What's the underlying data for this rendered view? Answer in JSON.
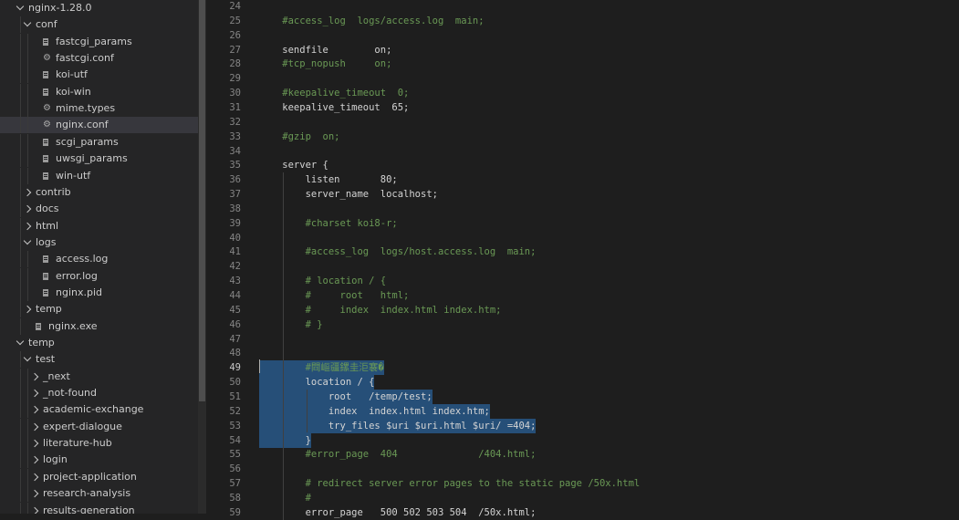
{
  "explorer": {
    "items": [
      {
        "label": "nginx-1.28.0",
        "type": "folder",
        "open": true,
        "depth": 0
      },
      {
        "label": "conf",
        "type": "folder",
        "open": true,
        "depth": 1
      },
      {
        "label": "fastcgi_params",
        "type": "file",
        "icon": "file-lines-icon",
        "depth": 2
      },
      {
        "label": "fastcgi.conf",
        "type": "file",
        "icon": "gear-icon",
        "depth": 2
      },
      {
        "label": "koi-utf",
        "type": "file",
        "icon": "file-lines-icon",
        "depth": 2
      },
      {
        "label": "koi-win",
        "type": "file",
        "icon": "file-lines-icon",
        "depth": 2
      },
      {
        "label": "mime.types",
        "type": "file",
        "icon": "gear-icon",
        "depth": 2
      },
      {
        "label": "nginx.conf",
        "type": "file",
        "icon": "gear-icon",
        "depth": 2,
        "selected": true
      },
      {
        "label": "scgi_params",
        "type": "file",
        "icon": "file-lines-icon",
        "depth": 2
      },
      {
        "label": "uwsgi_params",
        "type": "file",
        "icon": "file-lines-icon",
        "depth": 2
      },
      {
        "label": "win-utf",
        "type": "file",
        "icon": "file-lines-icon",
        "depth": 2
      },
      {
        "label": "contrib",
        "type": "folder",
        "open": false,
        "depth": 1
      },
      {
        "label": "docs",
        "type": "folder",
        "open": false,
        "depth": 1
      },
      {
        "label": "html",
        "type": "folder",
        "open": false,
        "depth": 1
      },
      {
        "label": "logs",
        "type": "folder",
        "open": true,
        "depth": 1
      },
      {
        "label": "access.log",
        "type": "file",
        "icon": "file-lines-icon",
        "depth": 2
      },
      {
        "label": "error.log",
        "type": "file",
        "icon": "file-lines-icon",
        "depth": 2
      },
      {
        "label": "nginx.pid",
        "type": "file",
        "icon": "file-lines-icon",
        "depth": 2
      },
      {
        "label": "temp",
        "type": "folder",
        "open": false,
        "depth": 1
      },
      {
        "label": "nginx.exe",
        "type": "file",
        "icon": "file-lines-icon",
        "depth": 1
      },
      {
        "label": "temp",
        "type": "folder",
        "open": true,
        "depth": 0
      },
      {
        "label": "test",
        "type": "folder",
        "open": true,
        "depth": 1
      },
      {
        "label": "_next",
        "type": "folder",
        "open": false,
        "depth": 2
      },
      {
        "label": "_not-found",
        "type": "folder",
        "open": false,
        "depth": 2
      },
      {
        "label": "academic-exchange",
        "type": "folder",
        "open": false,
        "depth": 2
      },
      {
        "label": "expert-dialogue",
        "type": "folder",
        "open": false,
        "depth": 2
      },
      {
        "label": "literature-hub",
        "type": "folder",
        "open": false,
        "depth": 2
      },
      {
        "label": "login",
        "type": "folder",
        "open": false,
        "depth": 2
      },
      {
        "label": "project-application",
        "type": "folder",
        "open": false,
        "depth": 2
      },
      {
        "label": "research-analysis",
        "type": "folder",
        "open": false,
        "depth": 2
      },
      {
        "label": "results-generation",
        "type": "folder",
        "open": false,
        "depth": 2
      }
    ]
  },
  "editor": {
    "current_line": "49",
    "lines": [
      {
        "n": "24",
        "text": "",
        "kind": "code"
      },
      {
        "n": "25",
        "text": "    #access_log  logs/access.log  main;",
        "kind": "cmt"
      },
      {
        "n": "26",
        "text": "",
        "kind": "code"
      },
      {
        "n": "27",
        "text": "    sendfile        on;",
        "kind": "code"
      },
      {
        "n": "28",
        "text": "    #tcp_nopush     on;",
        "kind": "cmt"
      },
      {
        "n": "29",
        "text": "",
        "kind": "code"
      },
      {
        "n": "30",
        "text": "    #keepalive_timeout  0;",
        "kind": "cmt"
      },
      {
        "n": "31",
        "text": "    keepalive_timeout  65;",
        "kind": "code"
      },
      {
        "n": "32",
        "text": "",
        "kind": "code"
      },
      {
        "n": "33",
        "text": "    #gzip  on;",
        "kind": "cmt"
      },
      {
        "n": "34",
        "text": "",
        "kind": "code"
      },
      {
        "n": "35",
        "text": "    server {",
        "kind": "code"
      },
      {
        "n": "36",
        "text": "        listen       80;",
        "kind": "code"
      },
      {
        "n": "37",
        "text": "        server_name  localhost;",
        "kind": "code"
      },
      {
        "n": "38",
        "text": "",
        "kind": "code"
      },
      {
        "n": "39",
        "text": "        #charset koi8-r;",
        "kind": "cmt"
      },
      {
        "n": "40",
        "text": "",
        "kind": "code"
      },
      {
        "n": "41",
        "text": "        #access_log  logs/host.access.log  main;",
        "kind": "cmt"
      },
      {
        "n": "42",
        "text": "",
        "kind": "code"
      },
      {
        "n": "43",
        "text": "        # location / {",
        "kind": "cmt"
      },
      {
        "n": "44",
        "text": "        #     root   html;",
        "kind": "cmt"
      },
      {
        "n": "45",
        "text": "        #     index  index.html index.htm;",
        "kind": "cmt"
      },
      {
        "n": "46",
        "text": "        # }",
        "kind": "cmt"
      },
      {
        "n": "47",
        "text": "",
        "kind": "code"
      },
      {
        "n": "48",
        "text": "",
        "kind": "code"
      },
      {
        "n": "49",
        "text": "        #閰嶇疆鏍圭洰褰�",
        "kind": "cmt",
        "hl": true
      },
      {
        "n": "50",
        "text": "        location / {",
        "kind": "code",
        "hl": true
      },
      {
        "n": "51",
        "text": "            root   /temp/test;",
        "kind": "code",
        "hl": true
      },
      {
        "n": "52",
        "text": "            index  index.html index.htm;",
        "kind": "code",
        "hl": true
      },
      {
        "n": "53",
        "text": "            try_files $uri $uri.html $uri/ =404;",
        "kind": "code",
        "hl": true
      },
      {
        "n": "54",
        "text": "        }",
        "kind": "code",
        "hl": true
      },
      {
        "n": "55",
        "text": "        #error_page  404              /404.html;",
        "kind": "cmt"
      },
      {
        "n": "56",
        "text": "",
        "kind": "code"
      },
      {
        "n": "57",
        "text": "        # redirect server error pages to the static page /50x.html",
        "kind": "cmt"
      },
      {
        "n": "58",
        "text": "        #",
        "kind": "cmt"
      },
      {
        "n": "59",
        "text": "        error_page   500 502 503 504  /50x.html;",
        "kind": "code"
      }
    ]
  },
  "colors": {
    "sidebar_bg": "#252526",
    "editor_bg": "#1e1e1e",
    "selection": "#264f78",
    "comment": "#6a9955",
    "text": "#d4d4d4"
  }
}
